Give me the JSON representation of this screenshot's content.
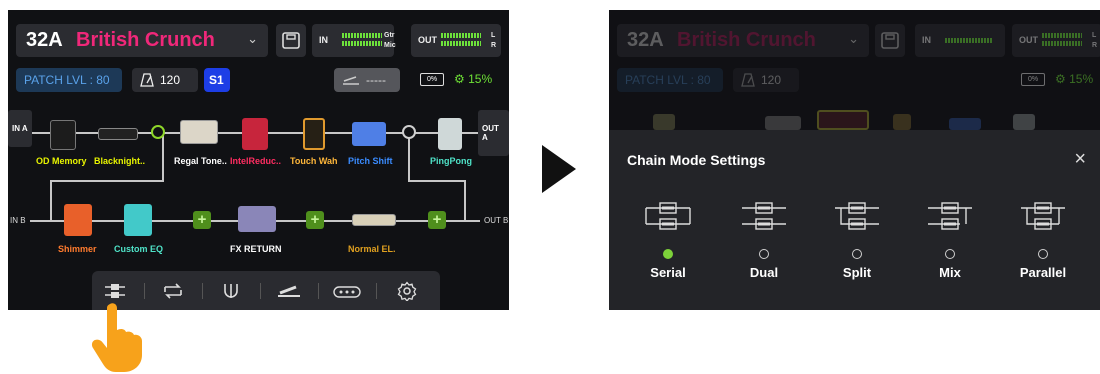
{
  "header": {
    "preset_number": "32A",
    "preset_name": "British Crunch",
    "in_label": "IN",
    "in_tag_top": "Gtr",
    "in_tag_bottom": "Mic",
    "out_label": "OUT",
    "out_tag_top": "L",
    "out_tag_bottom": "R"
  },
  "status": {
    "patch_level": "PATCH LVL : 80",
    "tempo": "120",
    "snapshot": "S1",
    "expression": "-----",
    "battery": "0%",
    "cpu": "15%"
  },
  "chain": {
    "in_a": "IN A",
    "out_a": "OUT A",
    "in_b": "IN B",
    "out_b": "OUT B",
    "row_a": [
      {
        "label": "OD Memory",
        "color": "#e8f500"
      },
      {
        "label": "Blacknight..",
        "color": "#e8f500"
      },
      {
        "label": "Regal Tone..",
        "color": "#ffffff"
      },
      {
        "label": "IntelReduc..",
        "color": "#ff2d61"
      },
      {
        "label": "Touch Wah",
        "color": "#ffb73a"
      },
      {
        "label": "Pitch Shift",
        "color": "#3a8cff"
      },
      {
        "label": "PingPong",
        "color": "#4fe3c8"
      }
    ],
    "row_b": [
      {
        "label": "Shimmer",
        "color": "#ff7b2e"
      },
      {
        "label": "Custom EQ",
        "color": "#4fe3c8"
      },
      {
        "label": "FX RETURN",
        "color": "#ffffff"
      },
      {
        "label": "Normal EL.",
        "color": "#e0a020"
      }
    ]
  },
  "toolbar": {
    "items": [
      "chain-mode-icon",
      "loop-icon",
      "tuner-icon",
      "expression-pedal-icon",
      "footswitch-icon",
      "settings-icon"
    ]
  },
  "dialog": {
    "title": "Chain Mode Settings",
    "close": "×",
    "modes": [
      {
        "label": "Serial",
        "selected": true
      },
      {
        "label": "Dual",
        "selected": false
      },
      {
        "label": "Split",
        "selected": false
      },
      {
        "label": "Mix",
        "selected": false
      },
      {
        "label": "Parallel",
        "selected": false
      }
    ]
  },
  "colors": {
    "accent_pink": "#f0287a",
    "accent_green": "#7dd13a",
    "hand": "#f7a21b"
  }
}
